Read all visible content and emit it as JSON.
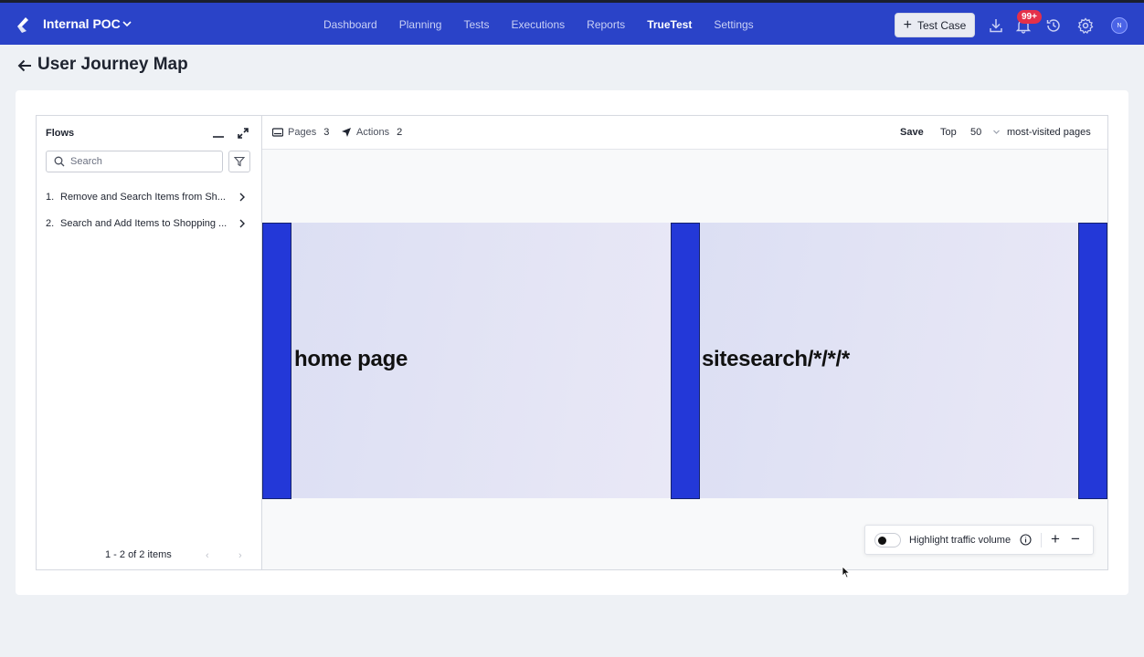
{
  "header": {
    "project": "Internal POC",
    "nav": [
      "Dashboard",
      "Planning",
      "Tests",
      "Executions",
      "Reports",
      "TrueTest",
      "Settings"
    ],
    "active_nav": "TrueTest",
    "test_case_button": "Test Case",
    "notification_badge": "99+",
    "avatar_initial": "N",
    "icons": [
      "logo-icon",
      "chevron-down-icon",
      "plus-icon",
      "download-icon",
      "bell-icon",
      "history-icon",
      "gear-icon"
    ]
  },
  "page": {
    "title": "User Journey Map"
  },
  "flows": {
    "title": "Flows",
    "search_placeholder": "Search",
    "items": [
      {
        "num": "1.",
        "label": "Remove and Search Items from Sh..."
      },
      {
        "num": "2.",
        "label": "Search and Add Items to Shopping ..."
      }
    ],
    "pagination": "1 - 2 of 2 items"
  },
  "map": {
    "pages_label": "Pages",
    "pages_count": "3",
    "actions_label": "Actions",
    "actions_count": "2",
    "save_label": "Save",
    "top_label": "Top",
    "top_value": "50",
    "most_visited_label": "most-visited pages",
    "nodes": [
      {
        "label": "home page"
      },
      {
        "label": "sitesearch/*/*/*"
      }
    ],
    "highlight_label": "Highlight traffic volume",
    "highlight_on": false
  },
  "colors": {
    "nav_bg": "#2a43c8",
    "node_bar": "#2338d8",
    "badge": "#e5304a"
  }
}
